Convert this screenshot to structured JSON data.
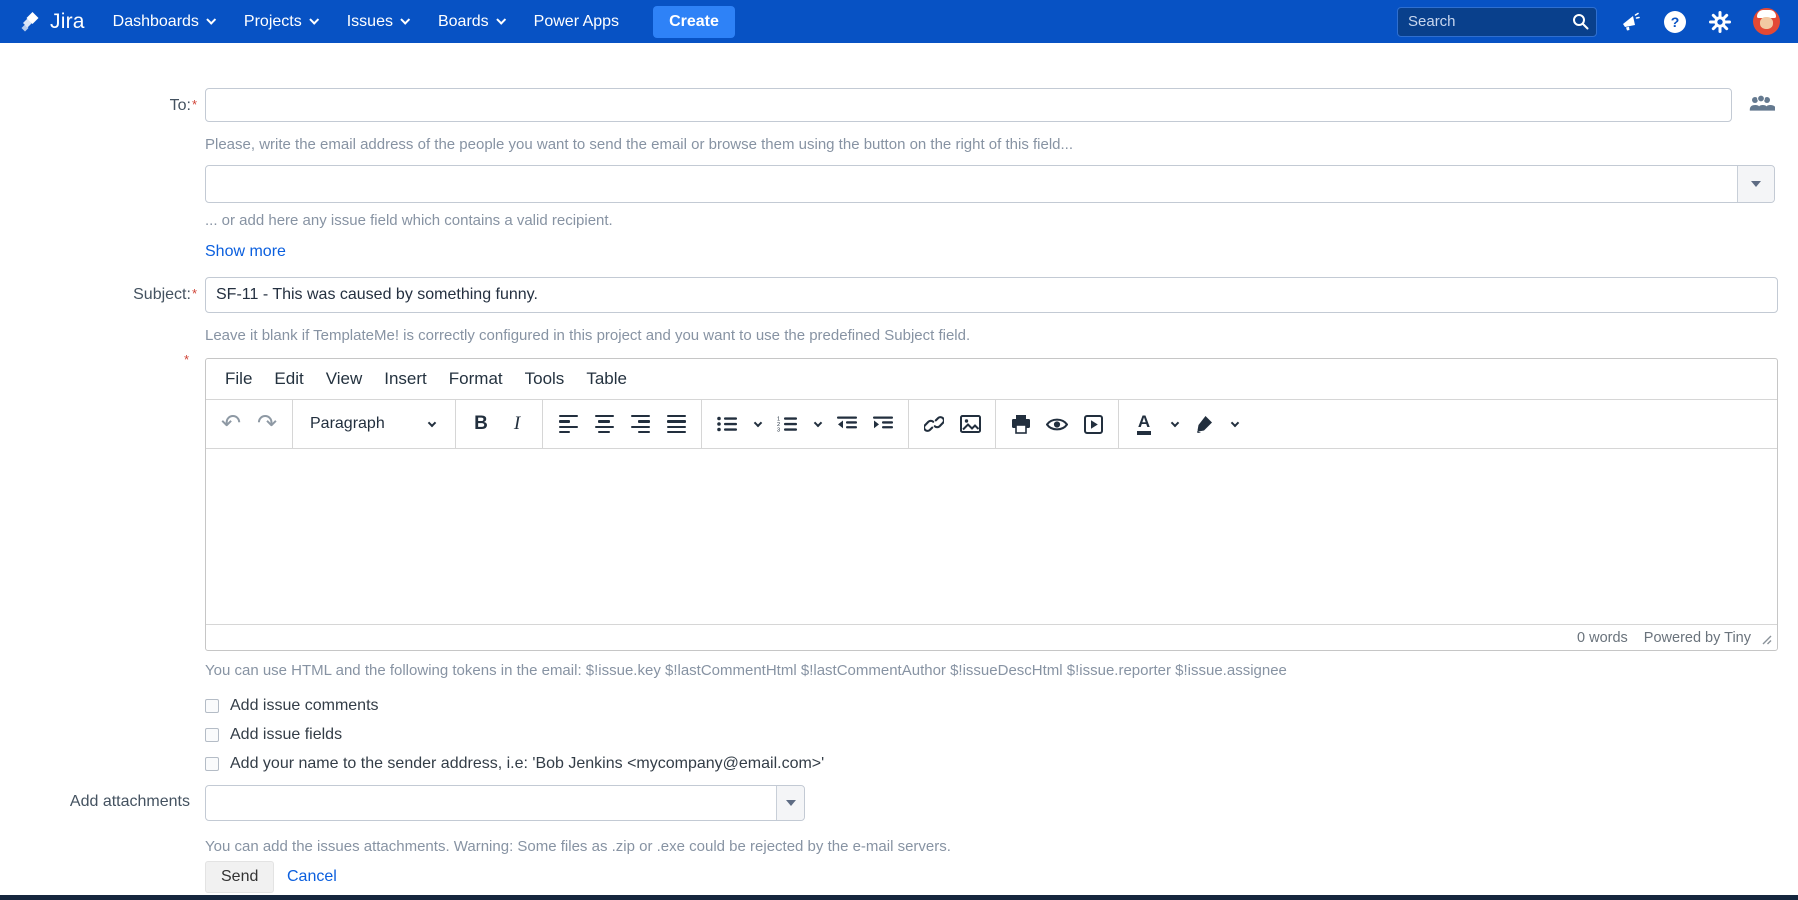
{
  "navbar": {
    "brand": "Jira",
    "items": [
      {
        "label": "Dashboards",
        "dropdown": true
      },
      {
        "label": "Projects",
        "dropdown": true
      },
      {
        "label": "Issues",
        "dropdown": true
      },
      {
        "label": "Boards",
        "dropdown": true
      },
      {
        "label": "Power Apps",
        "dropdown": false
      }
    ],
    "create_label": "Create",
    "search_placeholder": "Search"
  },
  "form": {
    "to": {
      "label": "To:",
      "required_mark": "*",
      "help": "Please, write the email address of the people you want to send the email or browse them using the button on the right of this field..."
    },
    "recipient_extra": {
      "help": "... or add here any issue field which contains a valid recipient."
    },
    "show_more_label": "Show more",
    "subject": {
      "label": "Subject:",
      "required_mark": "*",
      "value": "SF-11 - This was caused by something funny.",
      "help": "Leave it blank if TemplateMe! is correctly configured in this project and you want to use the predefined Subject field."
    },
    "editor": {
      "required_mark": "*",
      "menu": [
        "File",
        "Edit",
        "View",
        "Insert",
        "Format",
        "Tools",
        "Table"
      ],
      "paragraph_label": "Paragraph",
      "status": {
        "word_count": "0 words",
        "powered_by": "Powered by Tiny"
      }
    },
    "tokens_help": "You can use HTML and the following tokens in the email: $!issue.key $!lastCommentHtml $!lastCommentAuthor $!issueDescHtml $!issue.reporter $!issue.assignee",
    "checkboxes": [
      {
        "label": "Add issue comments",
        "checked": false
      },
      {
        "label": "Add issue fields",
        "checked": false
      },
      {
        "label": "Add your name to the sender address, i.e: 'Bob Jenkins <mycompany@email.com>'",
        "checked": false
      }
    ],
    "attachments": {
      "label": "Add attachments",
      "help": "You can add the issues attachments. Warning: Some files as .zip or .exe could be rejected by the e-mail servers."
    },
    "actions": {
      "send": "Send",
      "cancel": "Cancel"
    }
  },
  "icons": {
    "undo_glyph": "↶",
    "redo_glyph": "↷",
    "bold_glyph": "B",
    "italic_glyph": "I",
    "forecolor_glyph": "A",
    "help_glyph": "?",
    "names": [
      "jira-logo",
      "chevron-down-icon",
      "search-icon",
      "megaphone-icon",
      "help-icon",
      "gear-icon",
      "avatar",
      "people-icon",
      "dropdown-arrow-icon",
      "undo-icon",
      "redo-icon",
      "bold-icon",
      "italic-icon",
      "align-left-icon",
      "align-center-icon",
      "align-right-icon",
      "justify-icon",
      "bullet-list-icon",
      "numbered-list-icon",
      "outdent-icon",
      "indent-icon",
      "link-icon",
      "image-icon",
      "print-icon",
      "preview-icon",
      "media-icon",
      "text-color-icon",
      "highlight-color-icon",
      "resize-handle-icon"
    ]
  },
  "colors": {
    "navbar": "#0752C4",
    "create_button": "#2E82F7",
    "link": "#0B5FDE",
    "required": "#D04437",
    "help_text": "#8793A3",
    "editor_icon": "#222F3E",
    "bottom_bar": "#15263D"
  }
}
